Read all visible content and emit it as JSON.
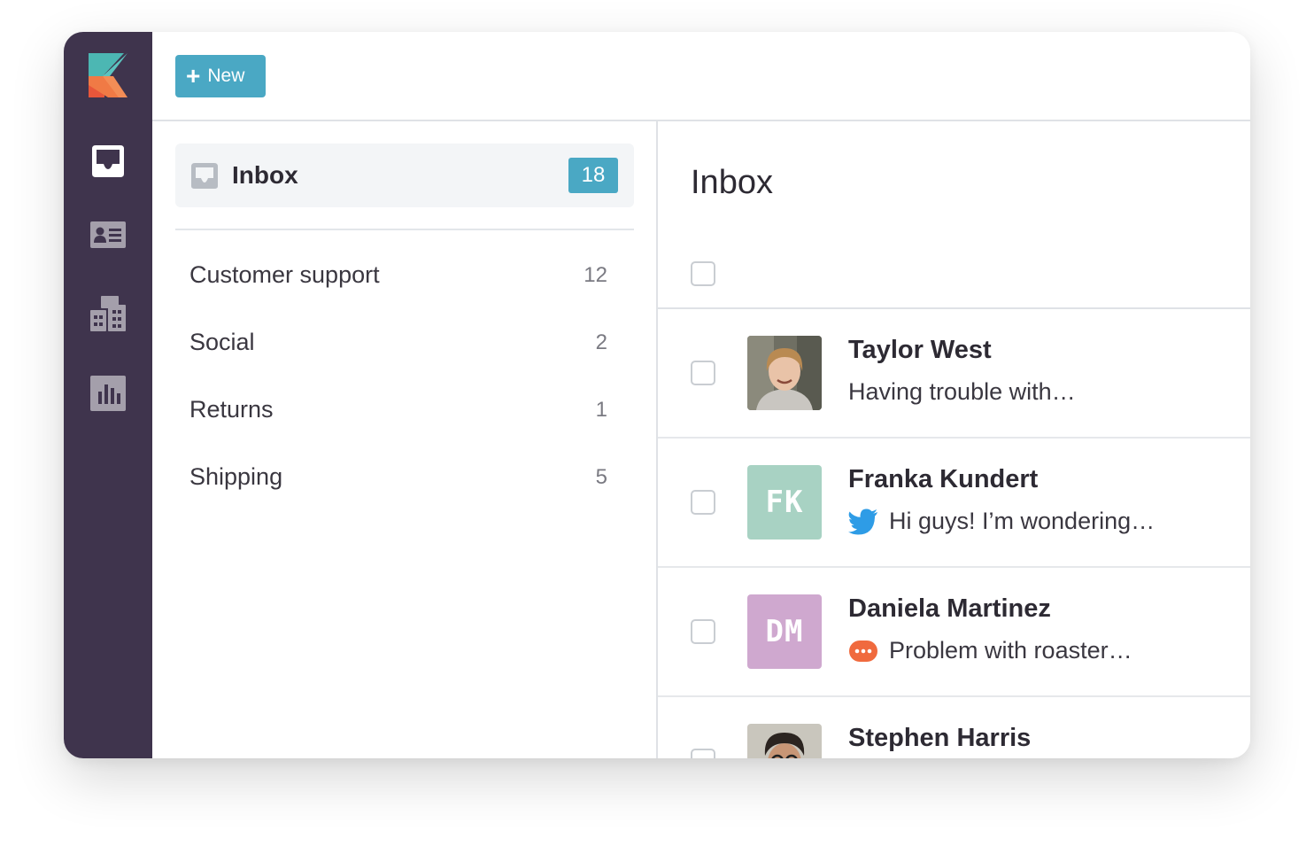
{
  "toolbar": {
    "new_label": "New"
  },
  "colors": {
    "sidebar": "#3f344d",
    "accent": "#4aa8c4",
    "fk_avatar": "#a8d2c3",
    "dm_avatar": "#cfa8cf",
    "twitter": "#2e9ce6",
    "chat": "#f06a3e"
  },
  "sidebar": {
    "items": [
      {
        "icon": "inbox-icon"
      },
      {
        "icon": "contact-card-icon"
      },
      {
        "icon": "buildings-icon"
      },
      {
        "icon": "bar-chart-icon"
      }
    ]
  },
  "folders": {
    "inbox": {
      "label": "Inbox",
      "count": "18"
    },
    "items": [
      {
        "label": "Customer support",
        "count": "12"
      },
      {
        "label": "Social",
        "count": "2"
      },
      {
        "label": "Returns",
        "count": "1"
      },
      {
        "label": "Shipping",
        "count": "5"
      }
    ]
  },
  "list": {
    "title": "Inbox",
    "rows": [
      {
        "name": "Taylor West",
        "message": "Having trouble with…",
        "avatar": "photo",
        "channel": ""
      },
      {
        "name": "Franka Kundert",
        "message": "Hi guys! I’m wondering…",
        "avatar": "FK",
        "channel": "twitter-icon"
      },
      {
        "name": "Daniela Martinez",
        "message": "Problem with roaster…",
        "avatar": "DM",
        "channel": "chat-bubble-icon"
      },
      {
        "name": "Stephen Harris",
        "message": "",
        "avatar": "photo",
        "channel": ""
      }
    ]
  }
}
